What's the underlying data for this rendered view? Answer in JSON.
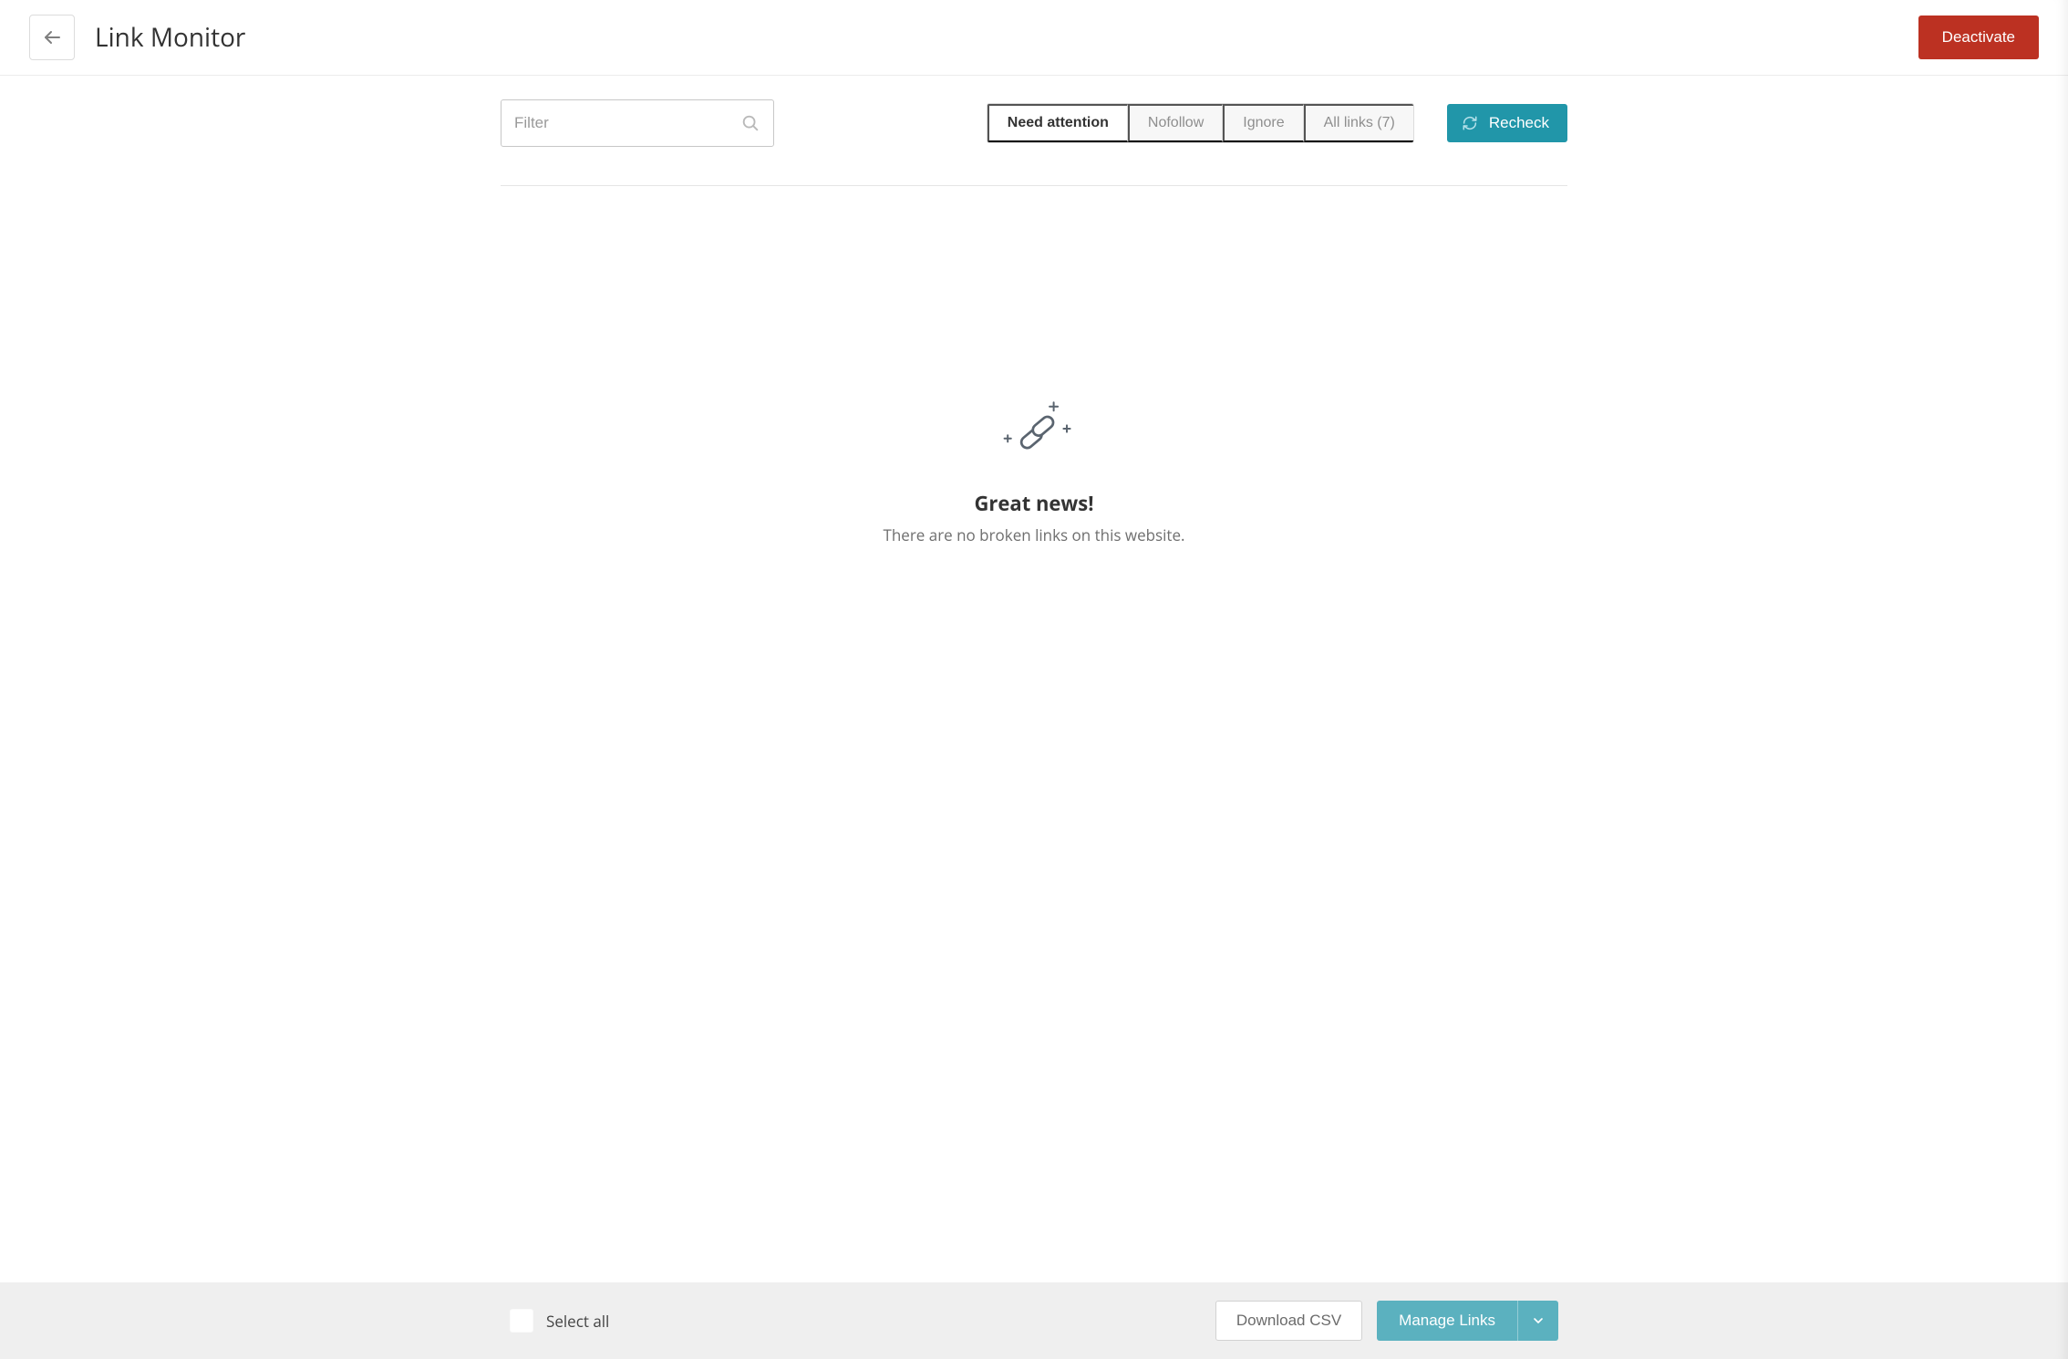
{
  "header": {
    "title": "Link Monitor",
    "deactivate_label": "Deactivate"
  },
  "filter": {
    "placeholder": "Filter",
    "value": ""
  },
  "tabs": {
    "items": [
      {
        "label": "Need attention",
        "active": true
      },
      {
        "label": "Nofollow",
        "active": false
      },
      {
        "label": "Ignore",
        "active": false
      },
      {
        "label": "All links (7)",
        "active": false
      }
    ]
  },
  "recheck_label": "Recheck",
  "empty_state": {
    "heading": "Great news!",
    "subtext": "There are no broken links on this website."
  },
  "footer": {
    "select_all_label": "Select all",
    "download_csv_label": "Download CSV",
    "manage_links_label": "Manage Links"
  }
}
